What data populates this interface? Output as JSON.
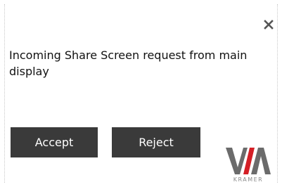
{
  "dialog": {
    "message": "Incoming Share Screen request from main display",
    "accept_label": "Accept",
    "reject_label": "Reject",
    "close_icon": "close-icon",
    "logo": {
      "brand": "VIA",
      "sub": "KRAMER"
    }
  },
  "colors": {
    "button_bg": "#3a3a3a",
    "button_text": "#ffffff",
    "logo_red": "#d41f26",
    "logo_gray": "#6b6b6b"
  }
}
